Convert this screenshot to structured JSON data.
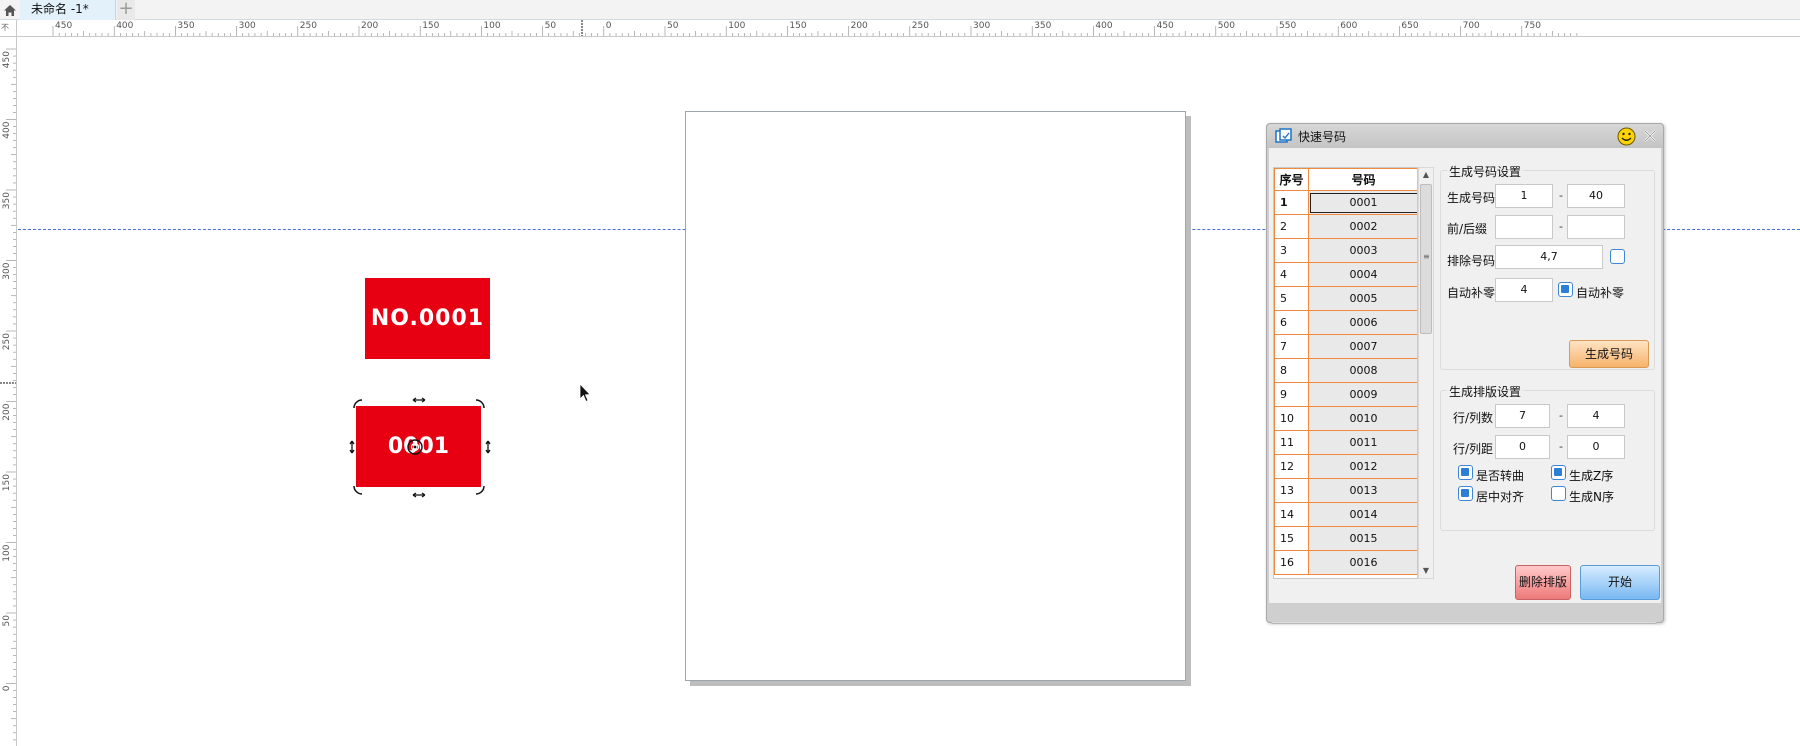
{
  "tabbar": {
    "home_icon": "home-icon",
    "document_tab": "未命名 -1*",
    "new_tab_symbol": "+"
  },
  "rulers": {
    "corner_mark": "不",
    "horizontal_labels": [
      "450",
      "400",
      "350",
      "300",
      "250",
      "200",
      "150",
      "100",
      "50",
      "0",
      "50",
      "100",
      "150",
      "200",
      "250",
      "300",
      "350",
      "400",
      "450",
      "500",
      "550",
      "600",
      "650",
      "700",
      "750"
    ],
    "vertical_labels": [
      "450",
      "400",
      "350",
      "300",
      "250",
      "200",
      "150",
      "100",
      "50",
      "0"
    ]
  },
  "canvas": {
    "label_top_text": "NO.0001",
    "label_selected_text": "0001",
    "guide_color": "#4a6fd6",
    "label_color": "#e60012"
  },
  "dialog": {
    "title": "快速号码",
    "icons": [
      "app-icon",
      "smiley-icon",
      "close-icon"
    ],
    "table": {
      "headers": [
        "序号",
        "号码"
      ],
      "rows": [
        {
          "seq": "1",
          "code": "0001"
        },
        {
          "seq": "2",
          "code": "0002"
        },
        {
          "seq": "3",
          "code": "0003"
        },
        {
          "seq": "4",
          "code": "0004"
        },
        {
          "seq": "5",
          "code": "0005"
        },
        {
          "seq": "6",
          "code": "0006"
        },
        {
          "seq": "7",
          "code": "0007"
        },
        {
          "seq": "8",
          "code": "0008"
        },
        {
          "seq": "9",
          "code": "0009"
        },
        {
          "seq": "10",
          "code": "0010"
        },
        {
          "seq": "11",
          "code": "0011"
        },
        {
          "seq": "12",
          "code": "0012"
        },
        {
          "seq": "13",
          "code": "0013"
        },
        {
          "seq": "14",
          "code": "0014"
        },
        {
          "seq": "15",
          "code": "0015"
        },
        {
          "seq": "16",
          "code": "0016"
        }
      ],
      "selected_row": "1"
    },
    "generate_group": {
      "title": "生成号码设置",
      "range_label": "生成号码",
      "range_from": "1",
      "range_to": "40",
      "affix_label": "前/后缀",
      "prefix": "",
      "suffix": "",
      "exclude_label": "排除号码",
      "exclude_value": "4,7",
      "pad_label": "自动补零",
      "pad_value": "4",
      "pad_checkbox_label": "自动补零",
      "generate_button": "生成号码",
      "dash": "-"
    },
    "layout_group": {
      "title": "生成排版设置",
      "rowcol_label": "行/列数",
      "rows": "7",
      "cols": "4",
      "spacing_label": "行/列距",
      "row_spacing": "0",
      "col_spacing": "0",
      "dash": "-",
      "chk_curve": "是否转曲",
      "chk_z": "生成Z序",
      "chk_center": "居中对齐",
      "chk_n": "生成N序"
    },
    "buttons": {
      "delete_layout": "删除排版",
      "start": "开始"
    }
  }
}
